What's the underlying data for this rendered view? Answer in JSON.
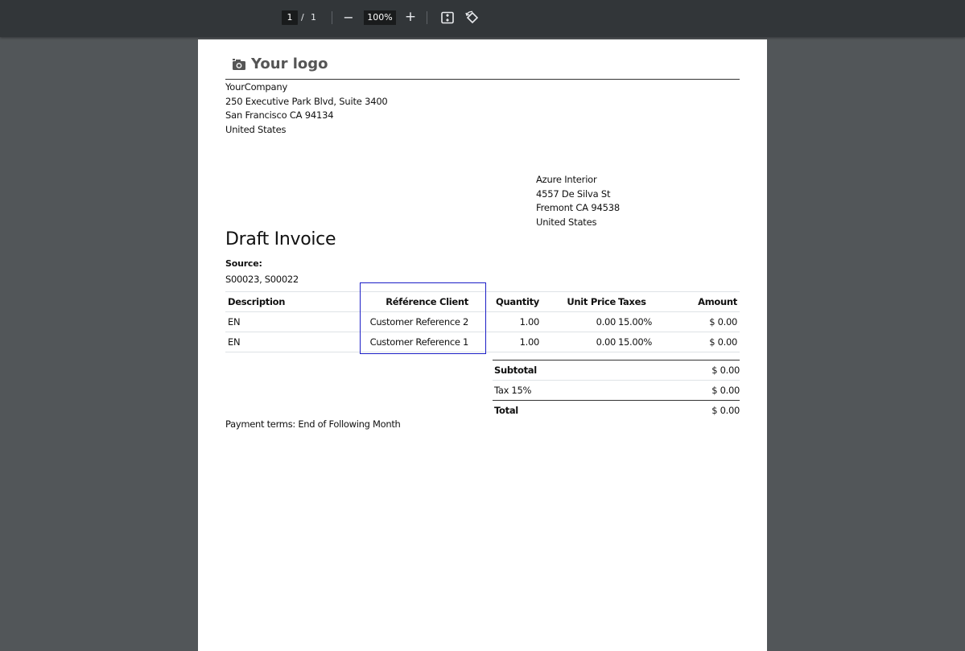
{
  "viewer": {
    "page_current": "1",
    "page_separator": "/",
    "page_total": "1",
    "zoom_out_symbol": "−",
    "zoom_level": "100%",
    "zoom_in_symbol": "+",
    "fit_icon": "fit-to-page-icon",
    "rotate_icon": "rotate-icon"
  },
  "document": {
    "logo_text": "Your logo",
    "logo_icon": "camera-icon",
    "company": {
      "name": "YourCompany",
      "street": "250 Executive Park Blvd, Suite 3400",
      "city": "San Francisco CA 94134",
      "country": "United States"
    },
    "partner": {
      "name": "Azure Interior",
      "street": "4557 De Silva St",
      "city": "Fremont CA 94538",
      "country": "United States"
    },
    "title": "Draft Invoice",
    "source_label": "Source:",
    "source_value": "S00023, S00022",
    "table": {
      "headers": {
        "description": "Description",
        "reference": "Référence Client",
        "quantity": "Quantity",
        "unit_price": "Unit Price",
        "taxes": "Taxes",
        "amount": "Amount"
      },
      "rows": [
        {
          "description": "EN",
          "reference": "Customer Reference 2",
          "quantity": "1.00",
          "unit_price": "0.00",
          "taxes": "15.00%",
          "amount": "$ 0.00"
        },
        {
          "description": "EN",
          "reference": "Customer Reference 1",
          "quantity": "1.00",
          "unit_price": "0.00",
          "taxes": "15.00%",
          "amount": "$ 0.00"
        }
      ]
    },
    "totals": {
      "subtotal_label": "Subtotal",
      "subtotal_value": "$ 0.00",
      "tax_label": "Tax 15%",
      "tax_value": "$ 0.00",
      "total_label": "Total",
      "total_value": "$ 0.00"
    },
    "payment_terms": "Payment terms: End of Following Month"
  },
  "colors": {
    "viewer_background": "#525659",
    "toolbar": "#323639",
    "highlight_border": "#1c1ec6"
  }
}
